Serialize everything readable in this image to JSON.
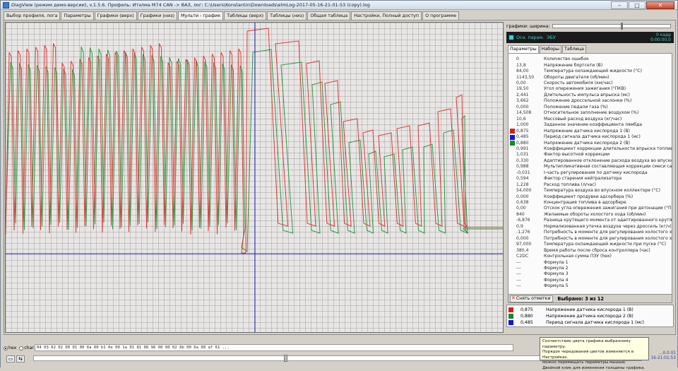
{
  "window": {
    "title": "DiagView (режим демо-версии), v.1.5.6. Профиль: Итэлма M74 CAN -> ВАЗ, лог: C:\\Users\\Konstantin\\Downloads\\elmLog-2017-05-16-21-01-53 (copy).log",
    "buttons": {
      "minimize": "–",
      "maximize": "□",
      "close": "✕"
    }
  },
  "tabs": [
    {
      "label": "Выбор профиля, лога",
      "active": false
    },
    {
      "label": "Параметры",
      "active": false
    },
    {
      "label": "Графики (верх)",
      "active": false
    },
    {
      "label": "Графики (низ)",
      "active": false
    },
    {
      "label": "Мульти - график",
      "active": true
    },
    {
      "label": "Таблицы (верх)",
      "active": false
    },
    {
      "label": "Таблицы (низ)",
      "active": false
    },
    {
      "label": "Общая таблица",
      "active": false
    },
    {
      "label": "Настройки, Полный доступ",
      "active": false
    },
    {
      "label": "О программе",
      "active": false
    }
  ],
  "right_panel": {
    "width_label": "графики:  ширина:",
    "width_slider_value": 0.58,
    "main_label": "Осн. парам.",
    "ecu_label": "ЭБУ",
    "frame_label": "0 кадр",
    "time_value": "0:00:00,0",
    "subtabs": [
      {
        "label": "Параметры",
        "active": true
      },
      {
        "label": "Наборы",
        "active": false
      },
      {
        "label": "Таблица",
        "active": false
      }
    ],
    "params": [
      {
        "value": "0",
        "name": "Количество ошибок",
        "color": ""
      },
      {
        "value": "13,8",
        "name": "Напряжение бортсети (В)",
        "color": ""
      },
      {
        "value": "84,00",
        "name": "Температура охлаждающей жидкости (°С)",
        "color": ""
      },
      {
        "value": "1143,50",
        "name": "Обороты двигателя (об/мин)",
        "color": ""
      },
      {
        "value": "0,00",
        "name": "Скорость автомобиля (км/час)",
        "color": ""
      },
      {
        "value": "19,50",
        "name": "Угол опережения зажигания (°ПКВ)",
        "color": ""
      },
      {
        "value": "2,441",
        "name": "Длительность импульса впрыска (мс)",
        "color": ""
      },
      {
        "value": "3,662",
        "name": "Положение дроссельной заслонки (%)",
        "color": ""
      },
      {
        "value": "0,000",
        "name": "Положение педали газа (%)",
        "color": ""
      },
      {
        "value": "14,508",
        "name": "Относительное заполнение воздухом (%)",
        "color": ""
      },
      {
        "value": "10,6",
        "name": "Массовый расход воздуха (кг/час)",
        "color": ""
      },
      {
        "value": "1,000",
        "name": "Заданное значение коэффициента лямбда",
        "color": ""
      },
      {
        "value": "0,875",
        "name": "Напряжение датчика кислорода 1 (В)",
        "color": "#d42020"
      },
      {
        "value": "0,485",
        "name": "Период сигнала датчика кислорода 1 (мс)",
        "color": "#1515d8"
      },
      {
        "value": "0,880",
        "name": "Напряжение датчика кислорода 2 (В)",
        "color": "#158a2a"
      },
      {
        "value": "0,991",
        "name": "Коэффициент коррекции длительности впрыска топлива",
        "color": ""
      },
      {
        "value": "1,031",
        "name": "Фактор высотной коррекции",
        "color": ""
      },
      {
        "value": "0,330",
        "name": "Адаптированное отклонение расхода воздуха во впускно...",
        "color": ""
      },
      {
        "value": "0,988",
        "name": "Мультипликативная составляющая коррекции смеси сам...",
        "color": ""
      },
      {
        "value": "-0,031",
        "name": "I-часть регулирования по датчику кислорода",
        "color": ""
      },
      {
        "value": "0,594",
        "name": "Фактор старения нейтрализатора",
        "color": ""
      },
      {
        "value": "1,228",
        "name": "Расход топлива (л/час)",
        "color": ""
      },
      {
        "value": "54,000",
        "name": "Температура воздуха во впускном коллекторе (°С)",
        "color": ""
      },
      {
        "value": "0,000",
        "name": "Коэффициент продувки адсорбера (%)",
        "color": ""
      },
      {
        "value": "0,638",
        "name": "Концентрация топлива в адсорбере",
        "color": ""
      },
      {
        "value": "0,00",
        "name": "Отскок угла опережения зажигания при детонации (°ПКВ)",
        "color": ""
      },
      {
        "value": "840",
        "name": "Желаемые обороты холостого хода (об/мин)",
        "color": ""
      },
      {
        "value": "-6,876",
        "name": "Разница крутящего момента от адаптированного крутящ...",
        "color": ""
      },
      {
        "value": "0,9",
        "name": "Нормализованная утечка воздуха через дроссель (кг/ч)",
        "color": ""
      },
      {
        "value": "-1,276",
        "name": "Потребность в моменте для регулирования холостого хо...",
        "color": ""
      },
      {
        "value": "0,000",
        "name": "Потребность в моменте для регулирования холостого хо...",
        "color": ""
      },
      {
        "value": "97,000",
        "name": "Температура охлаждающей жидкости при пуске (°С)",
        "color": ""
      },
      {
        "value": "380,4",
        "name": "Время работы после сброса контроллера (час)",
        "color": ""
      },
      {
        "value": "C2DC",
        "name": "Контрольная сумма ПЗУ (hex)",
        "color": ""
      },
      {
        "value": "---",
        "name": "Формула 1",
        "color": ""
      },
      {
        "value": "---",
        "name": "Формула 2",
        "color": ""
      },
      {
        "value": "---",
        "name": "Формула 3",
        "color": ""
      },
      {
        "value": "---",
        "name": "Формула 4",
        "color": ""
      },
      {
        "value": "---",
        "name": "Формула 5",
        "color": ""
      }
    ],
    "clear_button": "Снять отметки",
    "selected_count": "Выбрано: 3 из 12",
    "legend": [
      {
        "value": "0,875",
        "name": "Напряжение датчика кислорода 1 (В)",
        "color": "#d42020"
      },
      {
        "value": "0,880",
        "name": "Напряжение датчика кислорода 2 (В)",
        "color": "#158a2a"
      },
      {
        "value": "0,485",
        "name": "Период сигнала датчика кислорода 1 (мс)",
        "color": "#1515d8"
      }
    ]
  },
  "graph": {
    "cursor_position": 0.5,
    "series": [
      {
        "name": "Напряжение датчика кислорода 1 (В)",
        "color": "#e03a3a"
      },
      {
        "name": "Напряжение датчика кислорода 2 (В)",
        "color": "#2f9a45"
      },
      {
        "name": "Период сигнала датчика кислорода 1 (мс)",
        "color": "#2424c8"
      }
    ]
  },
  "bottom": {
    "radio_hex": "hex",
    "radio_char": "char",
    "hex_dump": "04 03 62 02 00 01 00 6a 00 b1 0e 00 1a 01 81 06 96 00 00 02 6b 00 6a 00 af 61 ...",
    "scrub_position": 0.41,
    "tooltip": [
      "Соответствие цвета графика выбранному параметру.",
      "Порядок чередования цветов изменяется в Настройках.",
      "можно перемещать параметры мышью.",
      "Двойной клик для изменения толщины графика."
    ],
    "corner_line1": "...0.0.01",
    "corner_line2": "16-21:01:53"
  }
}
